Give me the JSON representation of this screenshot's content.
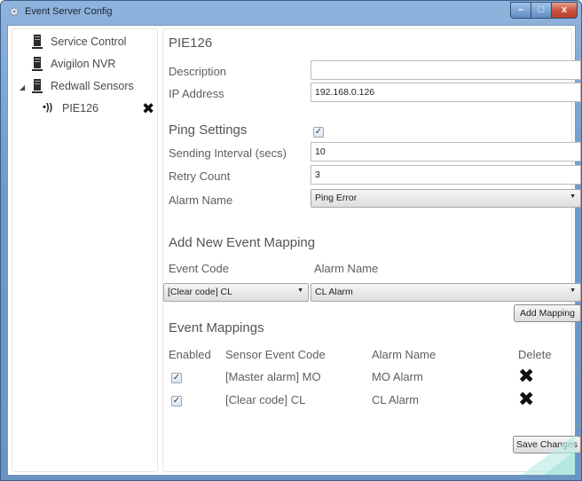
{
  "window": {
    "title": "Event Server Config",
    "controls": {
      "minimize": "–",
      "maximize": "□",
      "close": "x"
    }
  },
  "tree": {
    "items": [
      {
        "label": "Service Control",
        "icon": "server-icon"
      },
      {
        "label": "Avigilon NVR",
        "icon": "server-icon"
      },
      {
        "label": "Redwall Sensors",
        "icon": "server-icon",
        "expanded": true
      },
      {
        "label": "PIE126",
        "icon": "sensor-signal-icon",
        "selected": true
      }
    ],
    "expander": "◢",
    "sensor_glyph": "•))",
    "remove_glyph": "✖"
  },
  "device": {
    "name": "PIE126",
    "description_label": "Description",
    "description_value": "",
    "ip_label": "IP Address",
    "ip_value": "192.168.0.126"
  },
  "ping": {
    "heading": "Ping Settings",
    "enabled": true,
    "interval_label": "Sending Interval (secs)",
    "interval_value": "10",
    "retry_label": "Retry Count",
    "retry_value": "3",
    "alarm_label": "Alarm Name",
    "alarm_value": "Ping Error"
  },
  "new_mapping": {
    "heading": "Add New Event Mapping",
    "event_code_label": "Event Code",
    "alarm_name_label": "Alarm Name",
    "event_code_value": "[Clear code] CL",
    "alarm_name_value": "CL Alarm",
    "add_button": "Add Mapping"
  },
  "mappings": {
    "heading": "Event Mappings",
    "columns": [
      "Enabled",
      "Sensor Event Code",
      "Alarm Name",
      "Delete"
    ],
    "rows": [
      {
        "enabled": true,
        "code": "[Master alarm] MO",
        "alarm": "MO Alarm"
      },
      {
        "enabled": true,
        "code": "[Clear code] CL",
        "alarm": "CL Alarm"
      }
    ],
    "delete_glyph": "✖",
    "check_glyph": "✓"
  },
  "footer": {
    "save_button": "Save Changes"
  },
  "colors": {
    "title_bar": "#6f99c9",
    "close_button": "#c8503a",
    "accent_corner": "#aee8e0"
  }
}
